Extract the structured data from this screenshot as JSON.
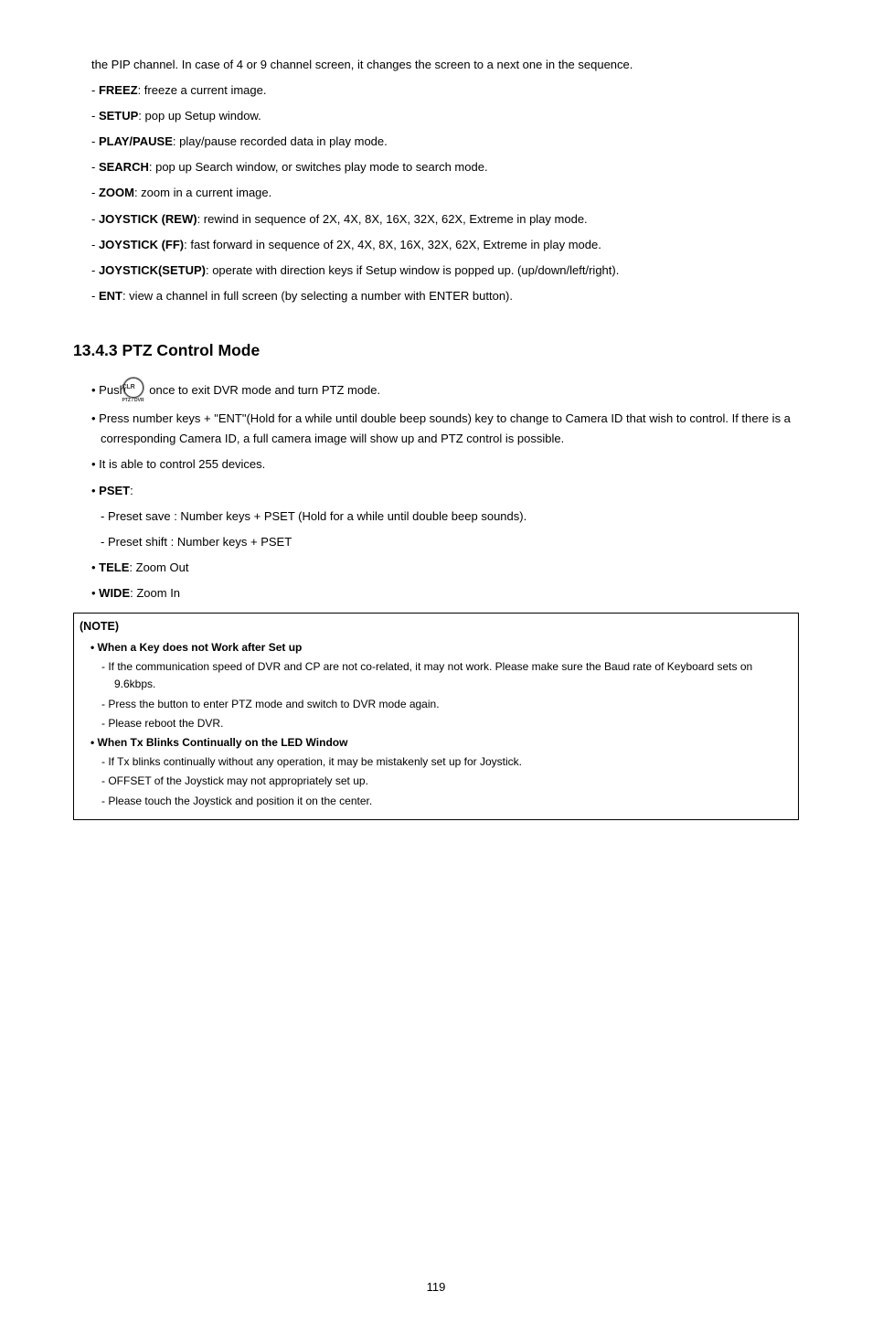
{
  "top": {
    "pip": "the PIP channel. In case of 4 or 9 channel screen, it changes the screen to a next one in the sequence.",
    "items": [
      {
        "key": "FREEZ",
        "desc": ": freeze a current image."
      },
      {
        "key": "SETUP",
        "desc": ": pop up Setup window."
      },
      {
        "key": "PLAY/PAUSE",
        "desc": ": play/pause recorded data in play mode."
      },
      {
        "key": "SEARCH",
        "desc": ": pop up Search window, or switches play mode to search mode."
      },
      {
        "key": "ZOOM",
        "desc": ": zoom in a current image."
      },
      {
        "key": "JOYSTICK (REW)",
        "desc": ": rewind in sequence of 2X, 4X, 8X, 16X, 32X, 62X, Extreme in play mode."
      },
      {
        "key": "JOYSTICK (FF)",
        "desc": ": fast forward in sequence of 2X, 4X, 8X, 16X, 32X, 62X, Extreme in play mode."
      },
      {
        "key": "JOYSTICK(SETUP)",
        "desc": ": operate with direction keys if Setup window is popped up. (up/down/left/right)."
      },
      {
        "key": "ENT",
        "desc": ": view a channel in full screen (by selecting a number with ENTER button)."
      }
    ]
  },
  "section": {
    "heading": "13.4.3  PTZ Control Mode",
    "icon": {
      "clr": "CLR",
      "sub": "PTZ / DVR"
    },
    "push_pre": "Push",
    "push_post": "once to exit DVR mode and turn PTZ mode.",
    "bullets": [
      "Press number keys + \"ENT\"(Hold for a while until double beep sounds) key to change to Camera ID that wish to control. If there is a corresponding Camera ID, a full camera image will show up and PTZ control is possible.",
      "It is able to control 255 devices."
    ],
    "pset_key": "PSET",
    "pset_colon": ":",
    "pset_subs": [
      "Preset save : Number keys + PSET (Hold for a while until double beep sounds).",
      "Preset shift : Number keys + PSET"
    ],
    "tele_key": "TELE",
    "tele_desc": ": Zoom Out",
    "wide_key": "WIDE",
    "wide_desc": ": Zoom In"
  },
  "note": {
    "title": "(NOTE)",
    "group1": {
      "head": "When a Key does not Work after Set up",
      "items": [
        "If the communication speed of DVR and CP are not co-related, it may not work. Please make sure the Baud rate of Keyboard sets on 9.6kbps.",
        "Press the button to enter PTZ mode and switch to DVR mode again.",
        "Please reboot the DVR."
      ]
    },
    "group2": {
      "head": "When Tx Blinks Continually on the LED Window",
      "items": [
        "If Tx blinks continually without any operation, it may be mistakenly set up for Joystick.",
        "OFFSET of the Joystick may not appropriately set up.",
        "Please touch the Joystick and position it on the center."
      ]
    }
  },
  "page_number": "119"
}
